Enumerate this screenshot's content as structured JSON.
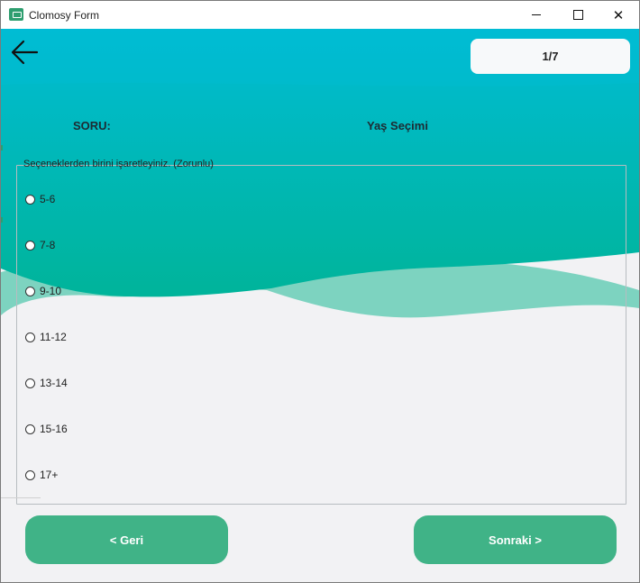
{
  "window": {
    "title": "Clomosy Form"
  },
  "header": {
    "progress": "1/7",
    "question_label": "SORU:",
    "question_title": "Yaş Seçimi",
    "colors": {
      "gradient_top": "#00bcd4",
      "gradient_bottom": "#00b49a",
      "wave_light": "#7dd3c0"
    }
  },
  "form": {
    "instruction": "Seçeneklerden birini işaretleyiniz. (Zorunlu)",
    "options": [
      "5-6",
      "7-8",
      "9-10",
      "11-12",
      "13-14",
      "15-16",
      "17+"
    ]
  },
  "buttons": {
    "back_label": "< Geri",
    "next_label": "Sonraki >",
    "color": "#40b387"
  },
  "icons": {
    "back": "arrow-left-icon",
    "app": "app-logo-icon"
  }
}
